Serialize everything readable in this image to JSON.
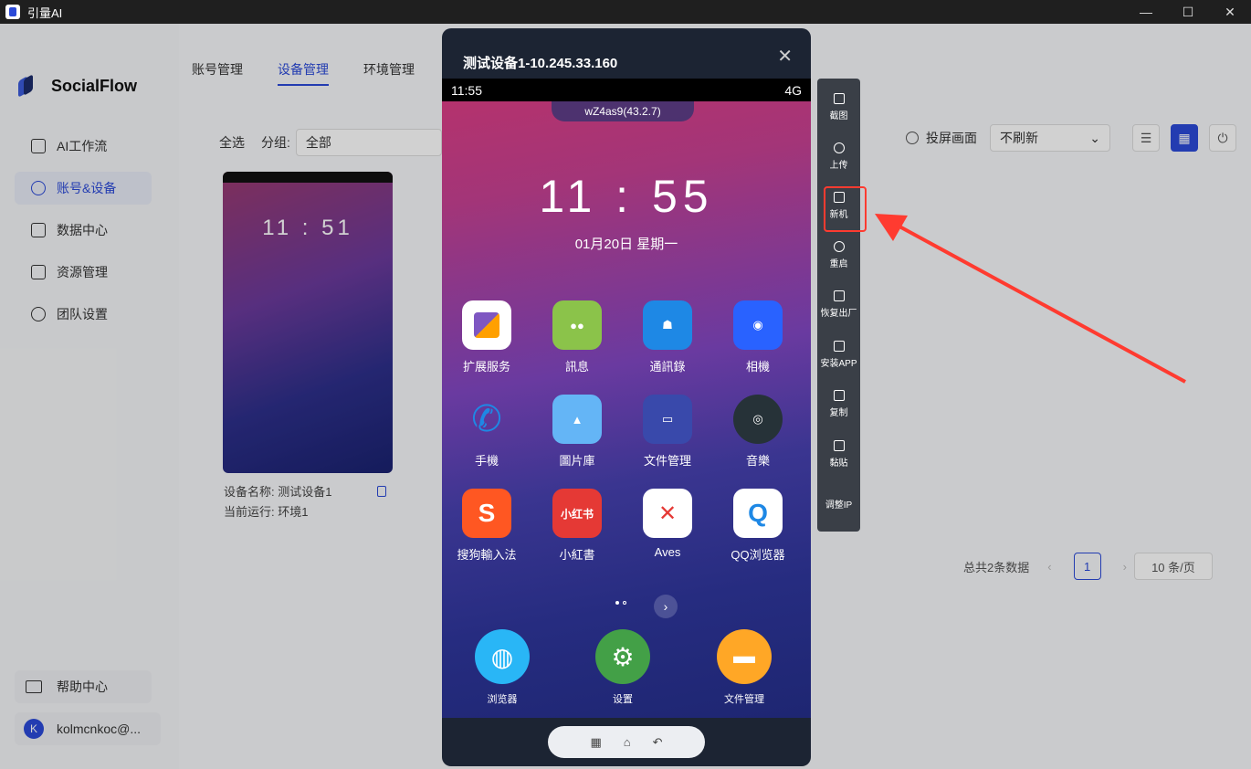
{
  "window": {
    "title": "引量AI"
  },
  "sidebar": {
    "brand": "SocialFlow",
    "items": [
      {
        "label": "AI工作流"
      },
      {
        "label": "账号&设备"
      },
      {
        "label": "数据中心"
      },
      {
        "label": "资源管理"
      },
      {
        "label": "团队设置"
      }
    ],
    "help": "帮助中心",
    "user_initial": "K",
    "user_name": "kolmcnkoc@..."
  },
  "tabs": [
    {
      "label": "账号管理"
    },
    {
      "label": "设备管理"
    },
    {
      "label": "环境管理"
    }
  ],
  "filter": {
    "select_all": "全选",
    "group_label": "分组:",
    "group_value": "全部"
  },
  "controls": {
    "screen_label": "投屏画面",
    "refresh_value": "不刷新"
  },
  "card": {
    "time": "11 : 51",
    "name_line": "设备名称: 测试设备1",
    "env_line": "当前运行: 环境1"
  },
  "pagination": {
    "total": "总共2条数据",
    "page": "1",
    "page_size": "10 条/页"
  },
  "modal": {
    "title": "测试设备1-10.245.33.160",
    "status_time": "11:55",
    "network": "4G",
    "notch_text": "wZ4as9(43.2.7)",
    "clock": "11 : 55",
    "date": "01月20日  星期一",
    "apps": [
      {
        "label": "扩展服务",
        "color": "#ffffff"
      },
      {
        "label": "訊息",
        "color": "#8bc34a"
      },
      {
        "label": "通訊錄",
        "color": "#1e88e5"
      },
      {
        "label": "相機",
        "color": "#2962ff"
      },
      {
        "label": "手機",
        "color": "#1e88e5"
      },
      {
        "label": "圖片庫",
        "color": "#64b5f6"
      },
      {
        "label": "文件管理",
        "color": "#3949ab"
      },
      {
        "label": "音樂",
        "color": "#263238"
      },
      {
        "label": "搜狗輸入法",
        "color": "#ff5722"
      },
      {
        "label": "小紅書",
        "color": "#e53935"
      },
      {
        "label": "Aves",
        "color": "#ffffff"
      },
      {
        "label": "QQ浏览器",
        "color": "#ffffff"
      }
    ],
    "dock": [
      {
        "label": "浏览器",
        "color": "#29b6f6"
      },
      {
        "label": "设置",
        "color": "#43a047"
      },
      {
        "label": "文件管理",
        "color": "#ffa726"
      }
    ],
    "xhs_text": "小红书"
  },
  "toolbar": [
    {
      "label": "截图"
    },
    {
      "label": "上传"
    },
    {
      "label": "新机"
    },
    {
      "label": "重启"
    },
    {
      "label": "恢复出厂"
    },
    {
      "label": "安装APP"
    },
    {
      "label": "复制"
    },
    {
      "label": "黏贴"
    },
    {
      "label": "调整IP"
    }
  ],
  "colors": {
    "accent": "#2b4ad8",
    "highlight": "#ff3b30"
  }
}
